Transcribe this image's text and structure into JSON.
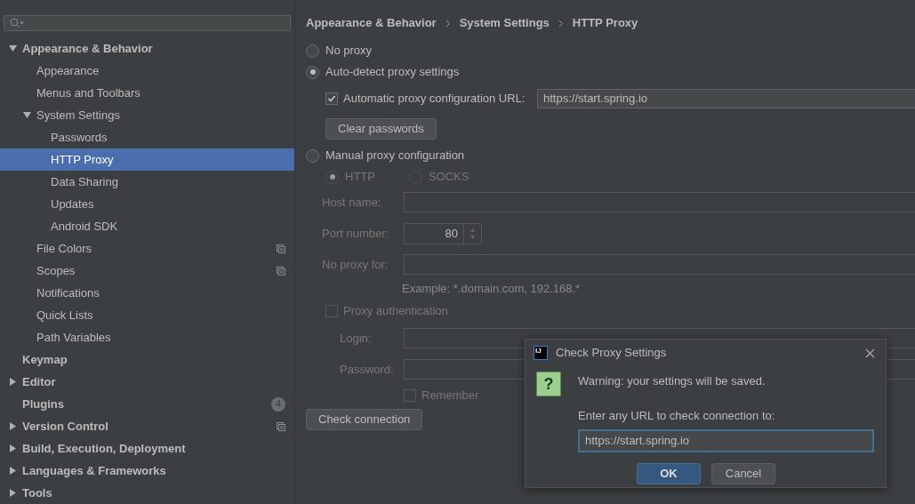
{
  "sidebar": {
    "items": [
      {
        "label": "Appearance & Behavior",
        "expanded": true,
        "selected": false,
        "children": [
          {
            "label": "Appearance",
            "selected": false
          },
          {
            "label": "Menus and Toolbars",
            "selected": false
          },
          {
            "label": "System Settings",
            "expanded": true,
            "selected": false,
            "children": [
              {
                "label": "Passwords",
                "selected": false
              },
              {
                "label": "HTTP Proxy",
                "selected": true
              },
              {
                "label": "Data Sharing",
                "selected": false
              },
              {
                "label": "Updates",
                "selected": false
              },
              {
                "label": "Android SDK",
                "selected": false
              }
            ]
          },
          {
            "label": "File Colors",
            "selected": false,
            "scoped": true
          },
          {
            "label": "Scopes",
            "selected": false,
            "scoped": true
          },
          {
            "label": "Notifications",
            "selected": false
          },
          {
            "label": "Quick Lists",
            "selected": false
          },
          {
            "label": "Path Variables",
            "selected": false
          }
        ]
      },
      {
        "label": "Keymap",
        "selected": false
      },
      {
        "label": "Editor",
        "expanded": false,
        "selected": false
      },
      {
        "label": "Plugins",
        "selected": false,
        "badge": "4"
      },
      {
        "label": "Version Control",
        "expanded": false,
        "selected": false,
        "scoped": true
      },
      {
        "label": "Build, Execution, Deployment",
        "expanded": false,
        "selected": false
      },
      {
        "label": "Languages & Frameworks",
        "expanded": false,
        "selected": false
      },
      {
        "label": "Tools",
        "expanded": false,
        "selected": false
      }
    ]
  },
  "breadcrumb": [
    "Appearance & Behavior",
    "System Settings",
    "HTTP Proxy"
  ],
  "proxy": {
    "no_proxy": {
      "label": "No proxy",
      "selected": false
    },
    "auto_detect": {
      "label": "Auto-detect proxy settings",
      "selected": true
    },
    "auto_url": {
      "label": "Automatic proxy configuration URL:",
      "checked": true,
      "value": "https://start.spring.io"
    },
    "clear_passwords": "Clear passwords",
    "manual": {
      "label": "Manual proxy configuration",
      "selected": false
    },
    "protocols": [
      {
        "label": "HTTP",
        "selected": true,
        "disabled": true
      },
      {
        "label": "SOCKS",
        "selected": false,
        "disabled": true
      }
    ],
    "host": {
      "label": "Host name:",
      "disabled": true
    },
    "port": {
      "label": "Port number:",
      "value": "80",
      "disabled": true
    },
    "no_proxy_for": {
      "label": "No proxy for:",
      "disabled": true
    },
    "example": "Example: *.domain.com, 192.168.*",
    "auth": {
      "label": "Proxy authentication",
      "checked": false,
      "disabled": true
    },
    "login": {
      "label": "Login:",
      "disabled": true
    },
    "password": {
      "label": "Password:",
      "disabled": true
    },
    "remember": {
      "label": "Remember",
      "checked": false,
      "disabled": true
    },
    "check_connection": "Check connection"
  },
  "dialog": {
    "title": "Check Proxy Settings",
    "logo": "IJ",
    "question": "?",
    "warning": "Warning: your settings will be saved.",
    "prompt": "Enter any URL to check connection to:",
    "url": "https://start.spring.io",
    "buttons": [
      {
        "label": "OK",
        "default": true
      },
      {
        "label": "Cancel",
        "default": false
      }
    ]
  }
}
